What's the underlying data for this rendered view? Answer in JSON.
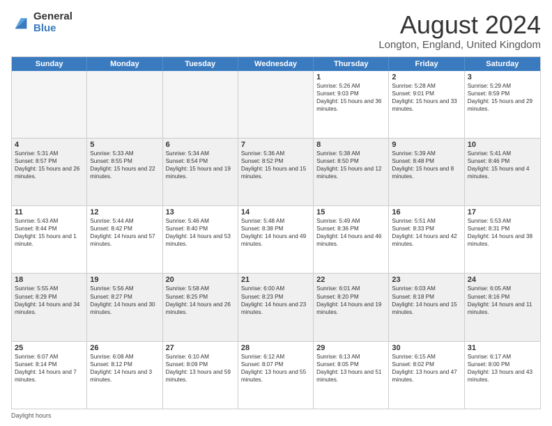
{
  "logo": {
    "general": "General",
    "blue": "Blue"
  },
  "title": "August 2024",
  "subtitle": "Longton, England, United Kingdom",
  "days_of_week": [
    "Sunday",
    "Monday",
    "Tuesday",
    "Wednesday",
    "Thursday",
    "Friday",
    "Saturday"
  ],
  "rows": [
    [
      {
        "day": "",
        "sunrise": "",
        "sunset": "",
        "daylight": "",
        "empty": true
      },
      {
        "day": "",
        "sunrise": "",
        "sunset": "",
        "daylight": "",
        "empty": true
      },
      {
        "day": "",
        "sunrise": "",
        "sunset": "",
        "daylight": "",
        "empty": true
      },
      {
        "day": "",
        "sunrise": "",
        "sunset": "",
        "daylight": "",
        "empty": true
      },
      {
        "day": "1",
        "sunrise": "Sunrise: 5:26 AM",
        "sunset": "Sunset: 9:03 PM",
        "daylight": "Daylight: 15 hours and 36 minutes."
      },
      {
        "day": "2",
        "sunrise": "Sunrise: 5:28 AM",
        "sunset": "Sunset: 9:01 PM",
        "daylight": "Daylight: 15 hours and 33 minutes."
      },
      {
        "day": "3",
        "sunrise": "Sunrise: 5:29 AM",
        "sunset": "Sunset: 8:59 PM",
        "daylight": "Daylight: 15 hours and 29 minutes."
      }
    ],
    [
      {
        "day": "4",
        "sunrise": "Sunrise: 5:31 AM",
        "sunset": "Sunset: 8:57 PM",
        "daylight": "Daylight: 15 hours and 26 minutes."
      },
      {
        "day": "5",
        "sunrise": "Sunrise: 5:33 AM",
        "sunset": "Sunset: 8:55 PM",
        "daylight": "Daylight: 15 hours and 22 minutes."
      },
      {
        "day": "6",
        "sunrise": "Sunrise: 5:34 AM",
        "sunset": "Sunset: 8:54 PM",
        "daylight": "Daylight: 15 hours and 19 minutes."
      },
      {
        "day": "7",
        "sunrise": "Sunrise: 5:36 AM",
        "sunset": "Sunset: 8:52 PM",
        "daylight": "Daylight: 15 hours and 15 minutes."
      },
      {
        "day": "8",
        "sunrise": "Sunrise: 5:38 AM",
        "sunset": "Sunset: 8:50 PM",
        "daylight": "Daylight: 15 hours and 12 minutes."
      },
      {
        "day": "9",
        "sunrise": "Sunrise: 5:39 AM",
        "sunset": "Sunset: 8:48 PM",
        "daylight": "Daylight: 15 hours and 8 minutes."
      },
      {
        "day": "10",
        "sunrise": "Sunrise: 5:41 AM",
        "sunset": "Sunset: 8:46 PM",
        "daylight": "Daylight: 15 hours and 4 minutes."
      }
    ],
    [
      {
        "day": "11",
        "sunrise": "Sunrise: 5:43 AM",
        "sunset": "Sunset: 8:44 PM",
        "daylight": "Daylight: 15 hours and 1 minute."
      },
      {
        "day": "12",
        "sunrise": "Sunrise: 5:44 AM",
        "sunset": "Sunset: 8:42 PM",
        "daylight": "Daylight: 14 hours and 57 minutes."
      },
      {
        "day": "13",
        "sunrise": "Sunrise: 5:46 AM",
        "sunset": "Sunset: 8:40 PM",
        "daylight": "Daylight: 14 hours and 53 minutes."
      },
      {
        "day": "14",
        "sunrise": "Sunrise: 5:48 AM",
        "sunset": "Sunset: 8:38 PM",
        "daylight": "Daylight: 14 hours and 49 minutes."
      },
      {
        "day": "15",
        "sunrise": "Sunrise: 5:49 AM",
        "sunset": "Sunset: 8:36 PM",
        "daylight": "Daylight: 14 hours and 46 minutes."
      },
      {
        "day": "16",
        "sunrise": "Sunrise: 5:51 AM",
        "sunset": "Sunset: 8:33 PM",
        "daylight": "Daylight: 14 hours and 42 minutes."
      },
      {
        "day": "17",
        "sunrise": "Sunrise: 5:53 AM",
        "sunset": "Sunset: 8:31 PM",
        "daylight": "Daylight: 14 hours and 38 minutes."
      }
    ],
    [
      {
        "day": "18",
        "sunrise": "Sunrise: 5:55 AM",
        "sunset": "Sunset: 8:29 PM",
        "daylight": "Daylight: 14 hours and 34 minutes."
      },
      {
        "day": "19",
        "sunrise": "Sunrise: 5:56 AM",
        "sunset": "Sunset: 8:27 PM",
        "daylight": "Daylight: 14 hours and 30 minutes."
      },
      {
        "day": "20",
        "sunrise": "Sunrise: 5:58 AM",
        "sunset": "Sunset: 8:25 PM",
        "daylight": "Daylight: 14 hours and 26 minutes."
      },
      {
        "day": "21",
        "sunrise": "Sunrise: 6:00 AM",
        "sunset": "Sunset: 8:23 PM",
        "daylight": "Daylight: 14 hours and 23 minutes."
      },
      {
        "day": "22",
        "sunrise": "Sunrise: 6:01 AM",
        "sunset": "Sunset: 8:20 PM",
        "daylight": "Daylight: 14 hours and 19 minutes."
      },
      {
        "day": "23",
        "sunrise": "Sunrise: 6:03 AM",
        "sunset": "Sunset: 8:18 PM",
        "daylight": "Daylight: 14 hours and 15 minutes."
      },
      {
        "day": "24",
        "sunrise": "Sunrise: 6:05 AM",
        "sunset": "Sunset: 8:16 PM",
        "daylight": "Daylight: 14 hours and 11 minutes."
      }
    ],
    [
      {
        "day": "25",
        "sunrise": "Sunrise: 6:07 AM",
        "sunset": "Sunset: 8:14 PM",
        "daylight": "Daylight: 14 hours and 7 minutes."
      },
      {
        "day": "26",
        "sunrise": "Sunrise: 6:08 AM",
        "sunset": "Sunset: 8:12 PM",
        "daylight": "Daylight: 14 hours and 3 minutes."
      },
      {
        "day": "27",
        "sunrise": "Sunrise: 6:10 AM",
        "sunset": "Sunset: 8:09 PM",
        "daylight": "Daylight: 13 hours and 59 minutes."
      },
      {
        "day": "28",
        "sunrise": "Sunrise: 6:12 AM",
        "sunset": "Sunset: 8:07 PM",
        "daylight": "Daylight: 13 hours and 55 minutes."
      },
      {
        "day": "29",
        "sunrise": "Sunrise: 6:13 AM",
        "sunset": "Sunset: 8:05 PM",
        "daylight": "Daylight: 13 hours and 51 minutes."
      },
      {
        "day": "30",
        "sunrise": "Sunrise: 6:15 AM",
        "sunset": "Sunset: 8:02 PM",
        "daylight": "Daylight: 13 hours and 47 minutes."
      },
      {
        "day": "31",
        "sunrise": "Sunrise: 6:17 AM",
        "sunset": "Sunset: 8:00 PM",
        "daylight": "Daylight: 13 hours and 43 minutes."
      }
    ]
  ],
  "footer": "Daylight hours"
}
